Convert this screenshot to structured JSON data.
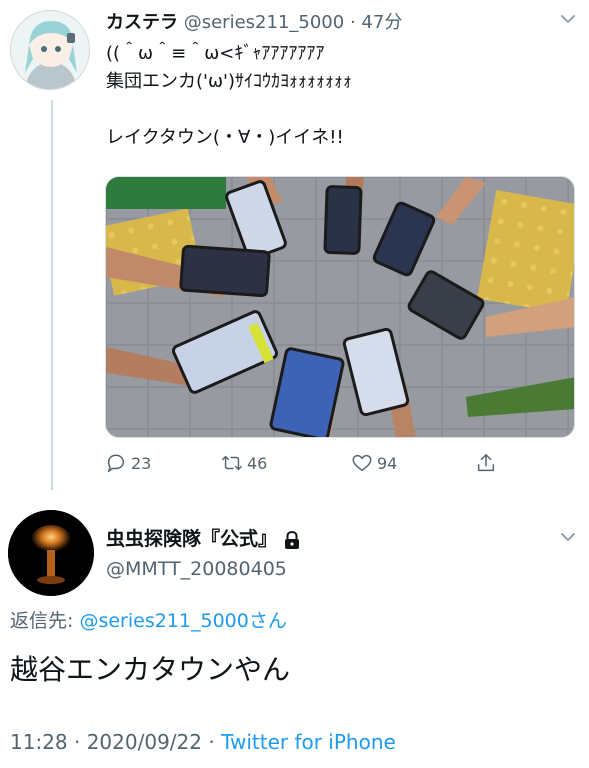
{
  "tweet1": {
    "display_name": "カステラ",
    "handle": "@series211_5000",
    "separator": "·",
    "time": "47分",
    "text": "((＾ω＾≡＾ω<ｷﾞｬｱｱｱｱｱｱｱ\n集団エンカ('ω')ｻｲｺｳｶﾖｫｫｫｫｫｫｫ\n\nレイクタウン(・∀・)イイネ!!",
    "actions": {
      "reply_count": "23",
      "retweet_count": "46",
      "like_count": "94"
    }
  },
  "tweet2": {
    "display_name": "虫虫探険隊『公式』",
    "handle": "@MMTT_20080405",
    "reply_prefix": "返信先: ",
    "reply_mention": "@series211_5000",
    "reply_suffix": "さん",
    "text": "越谷エンカタウンやん",
    "timestamp": "11:28 · 2020/09/22 · ",
    "source": "Twitter for iPhone"
  },
  "colors": {
    "accent": "#1d9bf0",
    "secondary_text": "#536471",
    "primary_text": "#0f1419",
    "thread_line": "#cfd9de"
  },
  "icons": [
    "chevron-down-icon",
    "reply-icon",
    "retweet-icon",
    "like-icon",
    "share-icon",
    "lock-icon"
  ]
}
